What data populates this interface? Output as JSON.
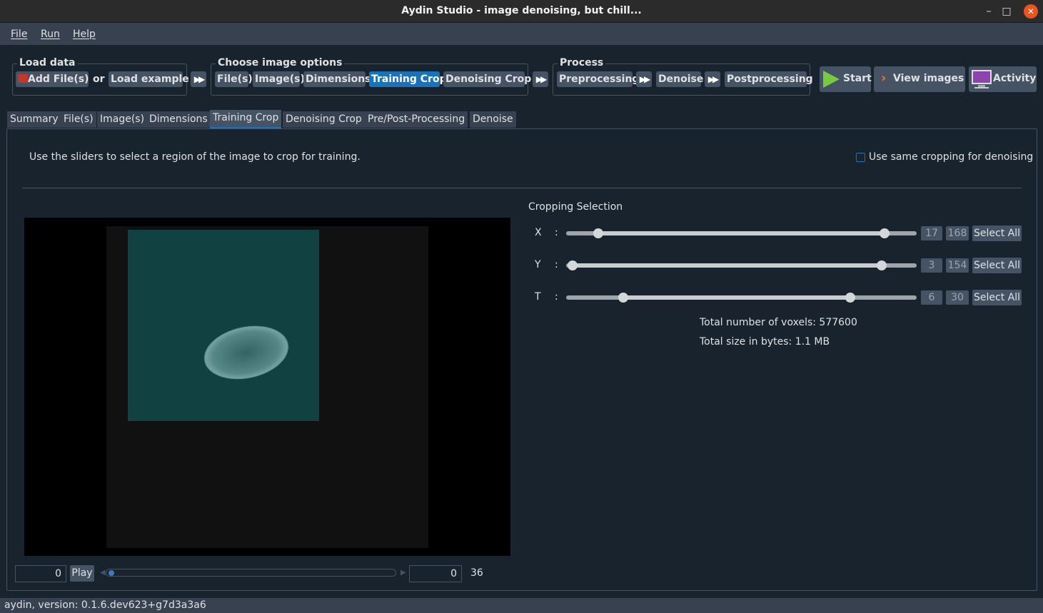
{
  "window": {
    "title": "Aydin Studio - image denoising, but chill..."
  },
  "menu": {
    "file": "File",
    "run": "Run",
    "help": "Help"
  },
  "toolbar": {
    "load_data": {
      "title": "Load data",
      "add_files": "Add File(s)",
      "or": "or",
      "load_example": "Load example"
    },
    "choose": {
      "title": "Choose image options",
      "files": "File(s)",
      "images": "Image(s)",
      "dimensions": "Dimensions",
      "training_crop": "Training Crop",
      "denoising_crop": "Denoising Crop"
    },
    "process": {
      "title": "Process",
      "preprocessing": "Preprocessing",
      "denoise": "Denoise",
      "postprocessing": "Postprocessing"
    },
    "start": "Start",
    "view_images": "View images",
    "activity": "Activity"
  },
  "tabs": [
    "Summary",
    "File(s)",
    "Image(s)",
    "Dimensions",
    "Training Crop",
    "Denoising Crop",
    "Pre/Post-Processing",
    "Denoise"
  ],
  "active_tab": "Training Crop",
  "panel": {
    "instructions": "Use the sliders to select a region of the image to crop for training.",
    "same_cropping_label": "Use same cropping for denoising",
    "same_cropping_checked": false
  },
  "viewer": {
    "frame_left": "0",
    "play": "Play",
    "frame_right": "0",
    "frame_max": "36",
    "frame_progress": 0
  },
  "cropping": {
    "title": "Cropping Selection",
    "axes": [
      {
        "label": "X",
        "colon": ":",
        "min": "17",
        "max": "168",
        "range": 185,
        "select_all": "Select All"
      },
      {
        "label": "Y",
        "colon": ":",
        "min": "3",
        "max": "154",
        "range": 171,
        "select_all": "Select All"
      },
      {
        "label": "T",
        "colon": ":",
        "min": "6",
        "max": "30",
        "range": 37,
        "select_all": "Select All"
      }
    ],
    "total_voxels": "Total number of voxels: 577600",
    "total_size": "Total size in bytes: 1.1 MB"
  },
  "status": "aydin, version: 0.1.6.dev623+g7d3a3a6",
  "colors": {
    "accent": "#1a72bb",
    "background": "#19232d",
    "button": "#455364",
    "start_green": "#7ac943",
    "view_orange": "#f0782d"
  }
}
